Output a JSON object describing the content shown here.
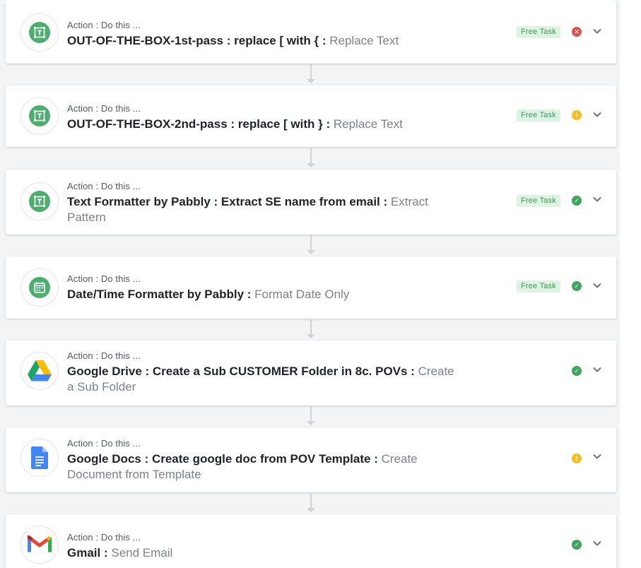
{
  "steps": [
    {
      "subtitle": "Action : Do this ...",
      "app": "OUT-OF-THE-BOX-1st-pass : replace [ with { :",
      "action": "Replace Text",
      "badge": "Free Task",
      "status": "error",
      "icon": "text-formatter-icon"
    },
    {
      "subtitle": "Action : Do this ...",
      "app": "OUT-OF-THE-BOX-2nd-pass : replace [ with } :",
      "action": "Replace Text",
      "badge": "Free Task",
      "status": "warning",
      "icon": "text-formatter-icon"
    },
    {
      "subtitle": "Action : Do this ...",
      "app": "Text Formatter by Pabbly : Extract SE name from email :",
      "action": "Extract Pattern",
      "badge": "Free Task",
      "status": "success",
      "icon": "text-formatter-icon"
    },
    {
      "subtitle": "Action : Do this ...",
      "app": "Date/Time Formatter by Pabbly :",
      "action": "Format Date Only",
      "badge": "Free Task",
      "status": "success",
      "icon": "calendar-icon"
    },
    {
      "subtitle": "Action : Do this ...",
      "app": "Google Drive : Create a Sub CUSTOMER Folder in 8c. POVs :",
      "action": "Create a Sub Folder",
      "badge": "",
      "status": "success",
      "icon": "google-drive-icon"
    },
    {
      "subtitle": "Action : Do this ...",
      "app": "Google Docs : Create google doc from POV Template :",
      "action": "Create Document from Template",
      "badge": "",
      "status": "warning",
      "icon": "google-docs-icon"
    },
    {
      "subtitle": "Action : Do this ...",
      "app": "Gmail :",
      "action": "Send Email",
      "badge": "",
      "status": "success",
      "icon": "gmail-icon"
    }
  ],
  "status_glyphs": {
    "error": "✕",
    "warning": "!",
    "success": "✓"
  },
  "colors": {
    "error": "#d9534f",
    "warning": "#f4c025",
    "success": "#3ea55b",
    "formatter_green": "#4caf70",
    "connector": "#cfd3d8"
  }
}
